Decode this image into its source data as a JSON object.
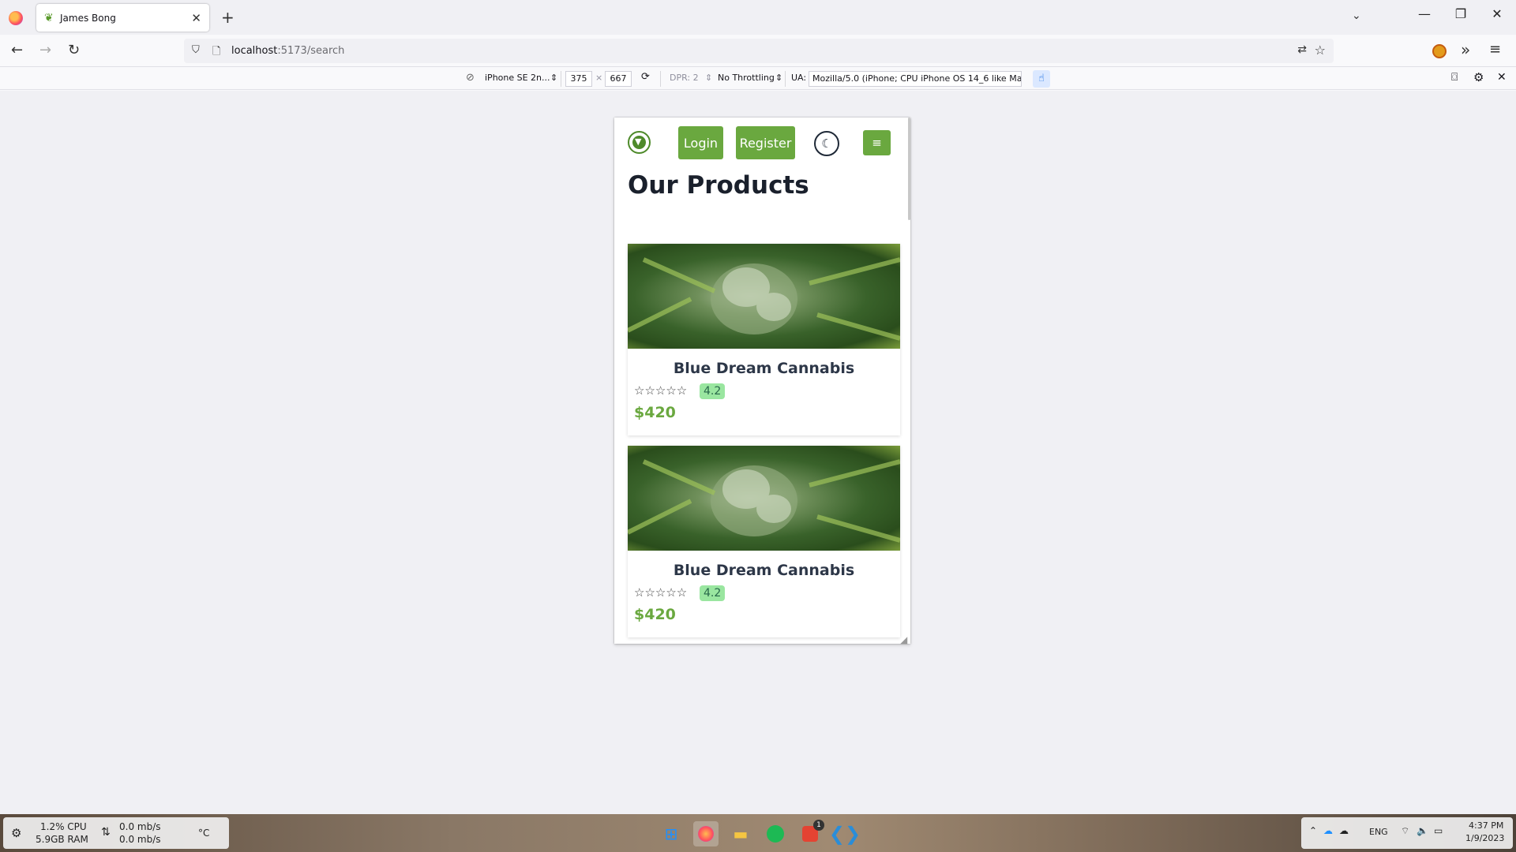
{
  "browser": {
    "tab_title": "James Bong",
    "url_host": "localhost",
    "url_path": ":5173/search"
  },
  "rdm": {
    "device": "iPhone SE 2n...",
    "width": "375",
    "height": "667",
    "times": "×",
    "dpr": "DPR: 2",
    "throttling": "No Throttling",
    "ua_label": "UA:",
    "ua_value": "Mozilla/5.0 (iPhone; CPU iPhone OS 14_6 like Mac"
  },
  "page": {
    "login_label": "Login",
    "register_label": "Register",
    "title": "Our Products",
    "products": [
      {
        "name": "Blue Dream Cannabis",
        "rating": "4.2",
        "price": "$420",
        "stars": "☆☆☆☆☆"
      },
      {
        "name": "Blue Dream Cannabis",
        "rating": "4.2",
        "price": "$420",
        "stars": "☆☆☆☆☆"
      }
    ]
  },
  "taskbar": {
    "cpu": "1.2% CPU",
    "ram": "5.9GB RAM",
    "net_up": "0.0 mb/s",
    "net_down": "0.0 mb/s",
    "temp": "°C",
    "lang": "ENG",
    "time": "4:37 PM",
    "date": "1/9/2023",
    "badge": "1"
  },
  "colors": {
    "brand_green": "#6aa83f",
    "rating_bg": "#9ae6a0"
  }
}
